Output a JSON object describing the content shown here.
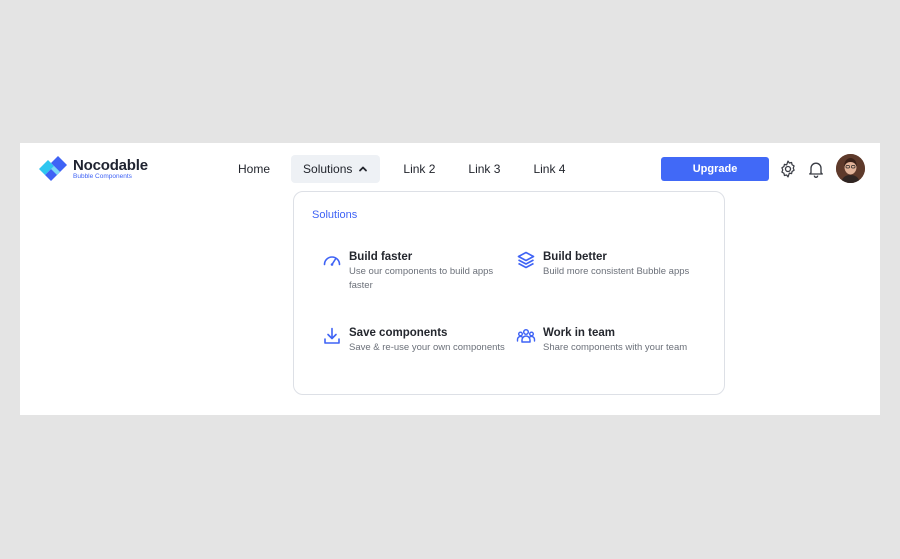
{
  "brand": {
    "name": "Nocodable",
    "tagline": "Bubble Components",
    "accent": "#3f63f5"
  },
  "nav": {
    "items": [
      {
        "label": "Home"
      },
      {
        "label": "Solutions",
        "active": true,
        "icon": "chevron-up-icon"
      },
      {
        "label": "Link 2"
      },
      {
        "label": "Link 3"
      },
      {
        "label": "Link 4"
      }
    ]
  },
  "header": {
    "upgrade_label": "Upgrade",
    "settings_icon": "gear-icon",
    "notifications_icon": "bell-icon",
    "avatar_icon": "user-avatar"
  },
  "dropdown": {
    "title": "Solutions",
    "items": [
      {
        "title": "Build faster",
        "description": "Use our components to build apps faster",
        "icon": "speedometer-icon"
      },
      {
        "title": "Build better",
        "description": "Build more consistent Bubble apps",
        "icon": "layers-icon"
      },
      {
        "title": "Save components",
        "description": "Save & re-use your own components",
        "icon": "download-icon"
      },
      {
        "title": "Work in team",
        "description": "Share components with your team",
        "icon": "team-icon"
      }
    ]
  }
}
